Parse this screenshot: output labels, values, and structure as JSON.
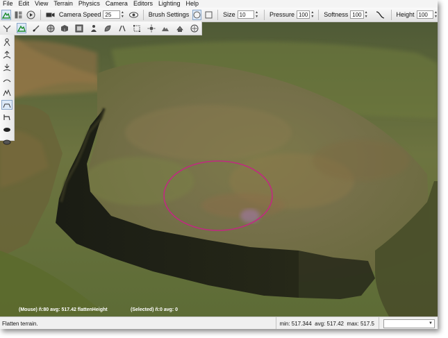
{
  "menu": [
    "File",
    "Edit",
    "View",
    "Terrain",
    "Physics",
    "Camera",
    "Editors",
    "Lighting",
    "Help"
  ],
  "toolbar": {
    "camera_speed_label": "Camera Speed",
    "camera_speed_value": "25",
    "brush_settings_label": "Brush Settings",
    "size_label": "Size",
    "size_value": "10",
    "pressure_label": "Pressure",
    "pressure_value": "100",
    "softness_label": "Softness",
    "softness_value": "100",
    "height_label": "Height",
    "height_value": "100"
  },
  "icons": {
    "toolbar1": [
      "terrain-editor-icon",
      "layout-icon",
      "play-icon",
      "camera-icon",
      "eye-icon",
      "circle-brush-icon",
      "square-brush-icon",
      "softness-curve-icon"
    ],
    "toolbar2": [
      "terrain-tool-icon",
      "terrain-select-icon",
      "paint-icon",
      "globe-icon",
      "box-icon",
      "texture-icon",
      "person-icon",
      "leaf-icon",
      "road-icon",
      "bounds-icon",
      "lighting-icon",
      "mountain-icon",
      "shape-icon",
      "grid-icon"
    ],
    "left": [
      "raise-height-icon",
      "lower-height-icon",
      "smooth-icon",
      "noise-icon",
      "adjust-height-icon",
      "flatten-icon",
      "dig-icon",
      "pit-icon",
      "clear-icon"
    ]
  },
  "hud": {
    "mouse_info": "(Mouse) ñ:80  avg: 517.42 flattenHeight",
    "selected_info": "(Selected) ñ:0  avg: 0"
  },
  "status": {
    "message": "Flatten terrain.",
    "min": "min: 517.344",
    "avg": "avg: 517.42",
    "max": "max: 517.5",
    "dropdown_value": ""
  },
  "colors": {
    "accent_blue": "#1a6ad0",
    "brush_ring": "#c02a80"
  }
}
